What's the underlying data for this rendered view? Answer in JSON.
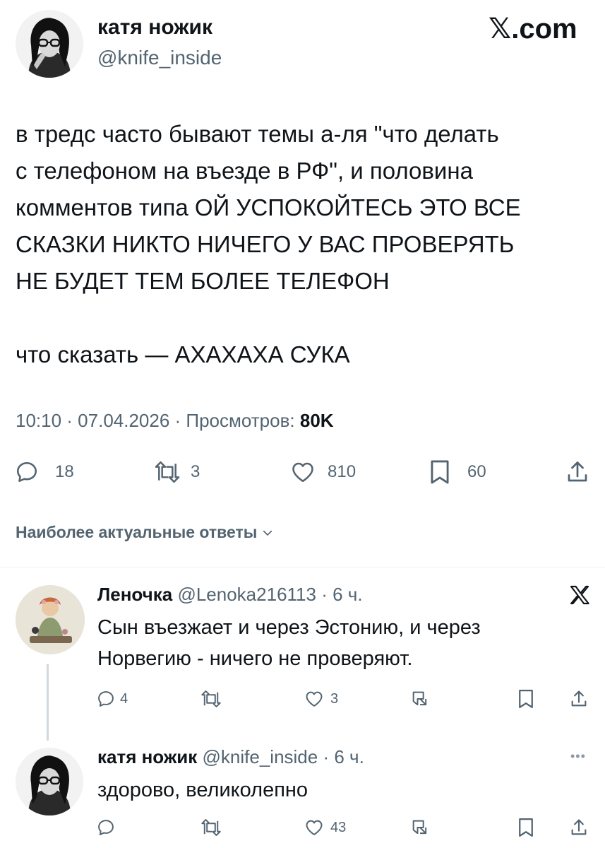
{
  "header": {
    "display_name": "катя ножик",
    "handle": "@knife_inside",
    "brand": "𝕏.com"
  },
  "tweet": {
    "lines": [
      "в тредс часто бывают темы а-ля \"что делать",
      "с телефоном на въезде в РФ\", и половина",
      "комментов типа ОЙ УСПОКОЙТЕСЬ ЭТО ВСЕ",
      "СКАЗКИ НИКТО НИЧЕГО У ВАС ПРОВЕРЯТЬ",
      "НЕ БУДЕТ ТЕМ БОЛЕЕ ТЕЛЕФОН",
      "что сказать — АХАХАХА СУКА"
    ],
    "meta_prefix": "10:10 · 07.04.2026 · Просмотров: ",
    "views": "80K",
    "stats": {
      "replies": "18",
      "reposts": "3",
      "likes": "810",
      "bookmarks": "60"
    }
  },
  "sort": {
    "label": "Наиболее актуальные ответы"
  },
  "replies": [
    {
      "name": "Леночка",
      "handle": "@Lenoka216113",
      "time": "· 6 ч.",
      "lines": [
        "Сын въезжает и через Эстонию, и через",
        "Норвегию - ничего не проверяют."
      ],
      "stats": {
        "replies": "4",
        "reposts": "",
        "likes": "3"
      }
    },
    {
      "name": "катя ножик",
      "handle": "@knife_inside",
      "time": "· 6 ч.",
      "lines": [
        "здорово, великолепно"
      ],
      "stats": {
        "replies": "",
        "reposts": "",
        "likes": "43"
      }
    }
  ],
  "icons": {
    "reply": "reply-icon",
    "repost": "repost-icon",
    "like": "like-icon",
    "bookmark": "bookmark-icon",
    "share": "share-icon",
    "grok": "grok-icon",
    "x_logo": "x-logo-icon",
    "more": "more-icon"
  }
}
